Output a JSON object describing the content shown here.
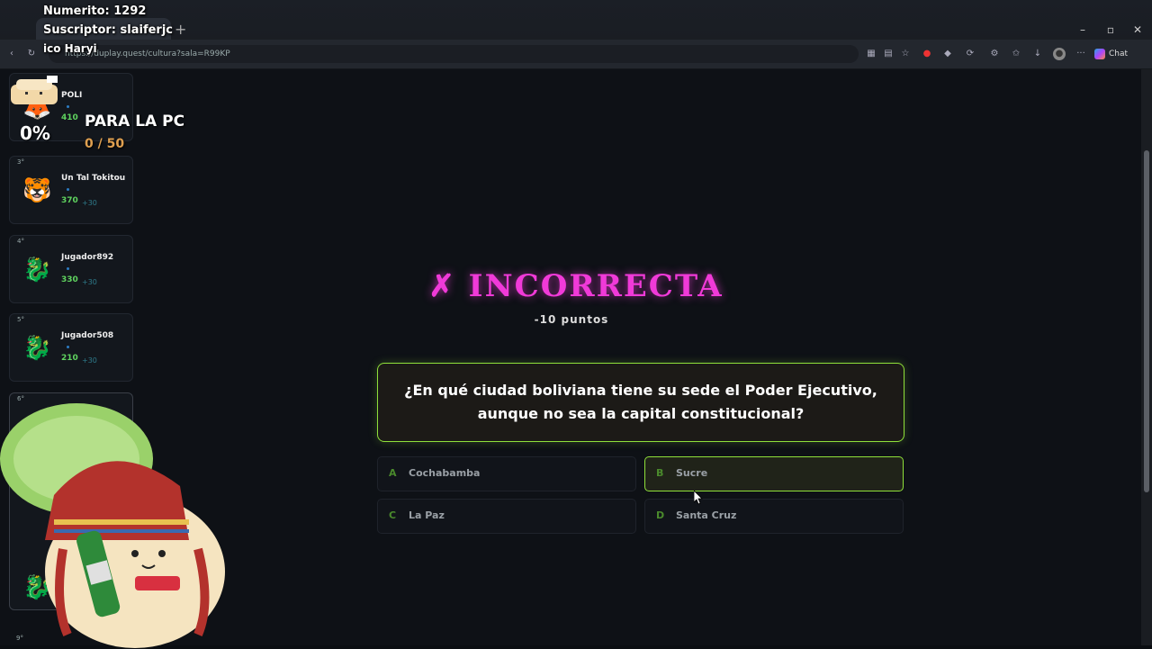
{
  "overlay": {
    "line1": "Numerito: 1292",
    "line2": "Suscriptor: slaiferjc",
    "line3": "ico   Haryi",
    "progress_percent_label": "0%",
    "goal_label": "PARA LA PC",
    "goal_count": "0 / 50"
  },
  "browser": {
    "url": "https://duplay.quest/cultura?sala=R99KP",
    "chat_label": "Chat"
  },
  "leaderboard": [
    {
      "rank": "",
      "name": "POLI",
      "score": "410",
      "delta": "",
      "avatar": "fox-avatar"
    },
    {
      "rank": "3°",
      "name": "Un Tal Tokitou",
      "score": "370",
      "delta": "+30",
      "avatar": "tiger-avatar"
    },
    {
      "rank": "4°",
      "name": "Jugador892",
      "score": "330",
      "delta": "+30",
      "avatar": "dragon-avatar"
    },
    {
      "rank": "5°",
      "name": "Jugador508",
      "score": "210",
      "delta": "+30",
      "avatar": "dragon-avatar"
    },
    {
      "rank": "6°",
      "name": "",
      "score": "",
      "delta": "",
      "avatar": "dragon-avatar"
    }
  ],
  "leaderboard_extra_rank": "9°",
  "result": {
    "title": "✗ INCORRECTA",
    "points": "-10 puntos"
  },
  "question": {
    "text": "¿En qué ciudad boliviana tiene su sede el Poder Ejecutivo, aunque no sea la capital constitucional?"
  },
  "options": [
    {
      "letter": "A",
      "text": "Cochabamba",
      "selected": false
    },
    {
      "letter": "B",
      "text": "Sucre",
      "selected": true
    },
    {
      "letter": "C",
      "text": "La Paz",
      "selected": false
    },
    {
      "letter": "D",
      "text": "Santa Cruz",
      "selected": false
    }
  ],
  "colors": {
    "incorrect": "#f03ad8",
    "accent_green": "#8fe03a",
    "score_green": "#5fd35f"
  }
}
